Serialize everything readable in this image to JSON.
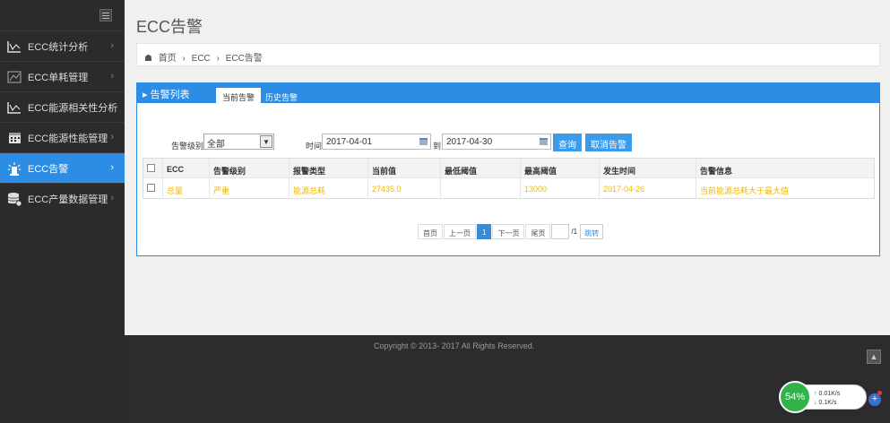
{
  "sidebar": {
    "items": [
      {
        "label": "ECC统计分析",
        "icon": "line-chart-icon",
        "active": false
      },
      {
        "label": "ECC单耗管理",
        "icon": "chart-icon",
        "active": false
      },
      {
        "label": "ECC能源相关性分析",
        "icon": "line-chart-icon",
        "active": false
      },
      {
        "label": "ECC能源性能管理",
        "icon": "calendar-icon",
        "active": false
      },
      {
        "label": "ECC告警",
        "icon": "alarm-icon",
        "active": true
      },
      {
        "label": "ECC产量数据管理",
        "icon": "database-icon",
        "active": false
      }
    ]
  },
  "page": {
    "title": "ECC告警"
  },
  "breadcrumb": {
    "home": "首页",
    "sep": "›",
    "level1": "ECC",
    "level2": "ECC告警"
  },
  "panel": {
    "title": "告警列表",
    "tabs": [
      "当前告警",
      "历史告警"
    ]
  },
  "filters": {
    "level_label": "告警级别",
    "level_value": "全部",
    "time_label": "时间",
    "start_date": "2017-04-01",
    "to_label": "到",
    "end_date": "2017-04-30",
    "query_button": "查询",
    "cancel_button": "取消告警"
  },
  "table": {
    "headers": [
      "ECC",
      "告警级别",
      "报警类型",
      "当前值",
      "最低阈值",
      "最高阈值",
      "发生时间",
      "告警信息"
    ],
    "rows": [
      [
        "总量",
        "严重",
        "能源总耗",
        "27435.0",
        "",
        "13000",
        "2017-04-26",
        "当前能源总耗大于最大值"
      ]
    ]
  },
  "pager": {
    "first": "首页",
    "prev": "上一页",
    "current": "1",
    "next": "下一页",
    "last": "尾页",
    "total": "/1",
    "go": "跳转"
  },
  "footer": {
    "copyright": "Copyright © 2013- 2017 All Rights Reserved."
  },
  "net_widget": {
    "percent": "54%",
    "up": "0.01K/s",
    "down": "0.1K/s"
  },
  "colors": {
    "accent": "#2d8ce3",
    "sidebar": "#2b2b2e",
    "warning_text": "#f0b800"
  }
}
